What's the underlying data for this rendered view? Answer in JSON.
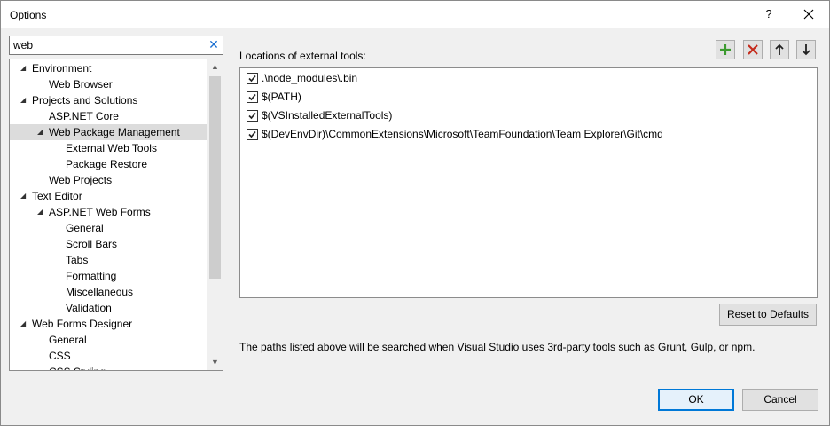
{
  "window": {
    "title": "Options",
    "help_label": "?",
    "close_label": "✕"
  },
  "search": {
    "value": "web",
    "clear_label": "✕"
  },
  "tree": {
    "items": [
      {
        "label": "Environment",
        "level": 0,
        "expanded": true,
        "selected": false
      },
      {
        "label": "Web Browser",
        "level": 1,
        "expanded": false,
        "selected": false
      },
      {
        "label": "Projects and Solutions",
        "level": 0,
        "expanded": true,
        "selected": false
      },
      {
        "label": "ASP.NET Core",
        "level": 1,
        "expanded": false,
        "selected": false
      },
      {
        "label": "Web Package Management",
        "level": 1,
        "expanded": true,
        "selected": true
      },
      {
        "label": "External Web Tools",
        "level": 2,
        "expanded": false,
        "selected": false
      },
      {
        "label": "Package Restore",
        "level": 2,
        "expanded": false,
        "selected": false
      },
      {
        "label": "Web Projects",
        "level": 1,
        "expanded": false,
        "selected": false
      },
      {
        "label": "Text Editor",
        "level": 0,
        "expanded": true,
        "selected": false
      },
      {
        "label": "ASP.NET Web Forms",
        "level": 1,
        "expanded": true,
        "selected": false
      },
      {
        "label": "General",
        "level": 2,
        "expanded": false,
        "selected": false
      },
      {
        "label": "Scroll Bars",
        "level": 2,
        "expanded": false,
        "selected": false
      },
      {
        "label": "Tabs",
        "level": 2,
        "expanded": false,
        "selected": false
      },
      {
        "label": "Formatting",
        "level": 2,
        "expanded": false,
        "selected": false
      },
      {
        "label": "Miscellaneous",
        "level": 2,
        "expanded": false,
        "selected": false
      },
      {
        "label": "Validation",
        "level": 2,
        "expanded": false,
        "selected": false
      },
      {
        "label": "Web Forms Designer",
        "level": 0,
        "expanded": true,
        "selected": false
      },
      {
        "label": "General",
        "level": 1,
        "expanded": false,
        "selected": false
      },
      {
        "label": "CSS",
        "level": 1,
        "expanded": false,
        "selected": false
      },
      {
        "label": "CSS Styling",
        "level": 1,
        "expanded": false,
        "selected": false
      }
    ]
  },
  "main": {
    "locations_label": "Locations of external tools:",
    "paths": [
      {
        "text": ".\\node_modules\\.bin",
        "checked": true
      },
      {
        "text": "$(PATH)",
        "checked": true
      },
      {
        "text": "$(VSInstalledExternalTools)",
        "checked": true
      },
      {
        "text": "$(DevEnvDir)\\CommonExtensions\\Microsoft\\TeamFoundation\\Team Explorer\\Git\\cmd",
        "checked": true
      }
    ],
    "reset_label": "Reset to Defaults",
    "note": "The paths listed above will be searched when Visual Studio uses 3rd-party tools such as Grunt, Gulp, or npm."
  },
  "footer": {
    "ok_label": "OK",
    "cancel_label": "Cancel"
  },
  "icons": {
    "add": "plus-icon",
    "remove": "x-icon",
    "up": "arrow-up-icon",
    "down": "arrow-down-icon"
  },
  "colors": {
    "add_green": "#3c9a2f",
    "remove_red": "#c42b1c",
    "accent": "#0078d7"
  }
}
